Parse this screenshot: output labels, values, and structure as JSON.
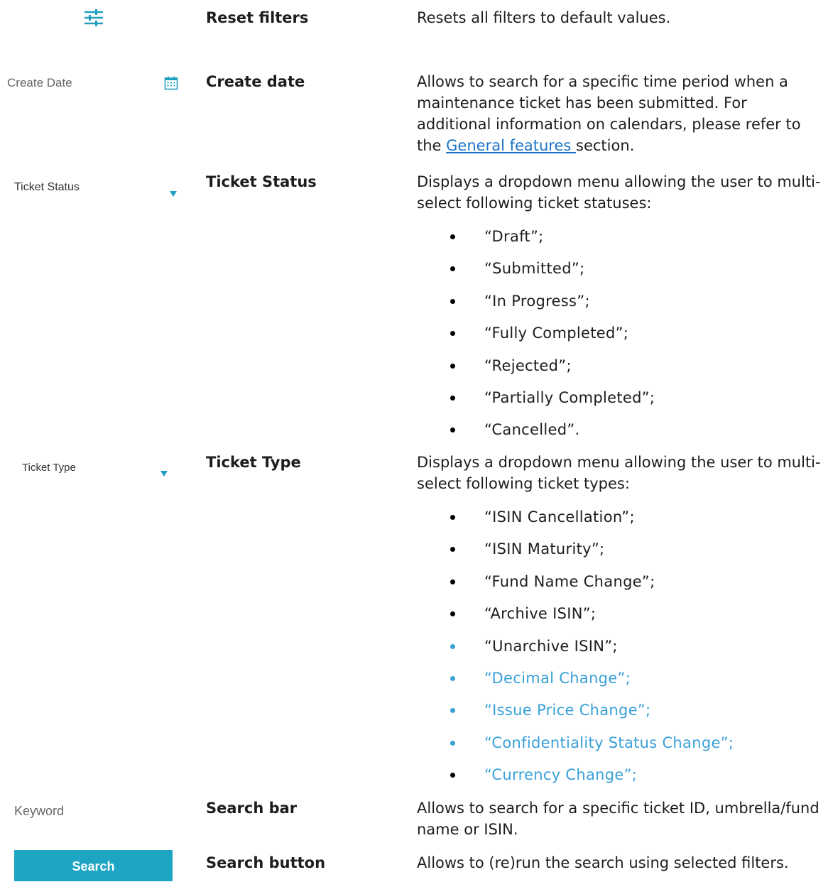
{
  "rows": {
    "reset": {
      "term": "Reset filters",
      "desc": "Resets all filters to default values."
    },
    "create_date": {
      "widget_label": "Create Date",
      "term": "Create date",
      "desc_before": "Allows to search for a specific time period when a maintenance ticket has been submitted. For additional information on calendars, please refer to the ",
      "link": "General features ",
      "desc_after": "section."
    },
    "ticket_status": {
      "widget_label": "Ticket Status",
      "term": "Ticket Status",
      "desc": "Displays a dropdown menu allowing the user to multi-select following ticket statuses:",
      "items": [
        "“Draft”;",
        "“Submitted”;",
        "“In Progress”;",
        "“Fully Completed”;",
        "“Rejected”;",
        "“Partially Completed”;",
        "“Cancelled”."
      ]
    },
    "ticket_type": {
      "widget_label": "Ticket Type",
      "term": "Ticket Type",
      "desc": "Displays a dropdown menu allowing the user to multi-select following ticket types:",
      "items": [
        "“ISIN Cancellation”;",
        "“ISIN Maturity”;",
        "“Fund Name Change”;",
        "“Archive ISIN”;",
        "“Unarchive ISIN”;",
        "“Decimal Change”;",
        "“Issue Price Change”;",
        "“Confidentiality Status Change”;",
        "“Currency Change”;"
      ]
    },
    "search_bar": {
      "placeholder": "Keyword",
      "term": "Search bar",
      "desc": "Allows to search for a specific ticket ID, umbrella/fund name or ISIN."
    },
    "search_button": {
      "button_label": "Search",
      "term": "Search button",
      "desc": "Allows to (re)run the search using selected filters."
    }
  },
  "colors": {
    "accent_teal": "#1f9fbf",
    "highlight_blue": "#3aa0d8",
    "link_blue": "#1a73c7",
    "button_bg": "#1ea5c3"
  },
  "icons": [
    "filter-sliders-icon",
    "calendar-icon",
    "dropdown-caret-icon"
  ]
}
